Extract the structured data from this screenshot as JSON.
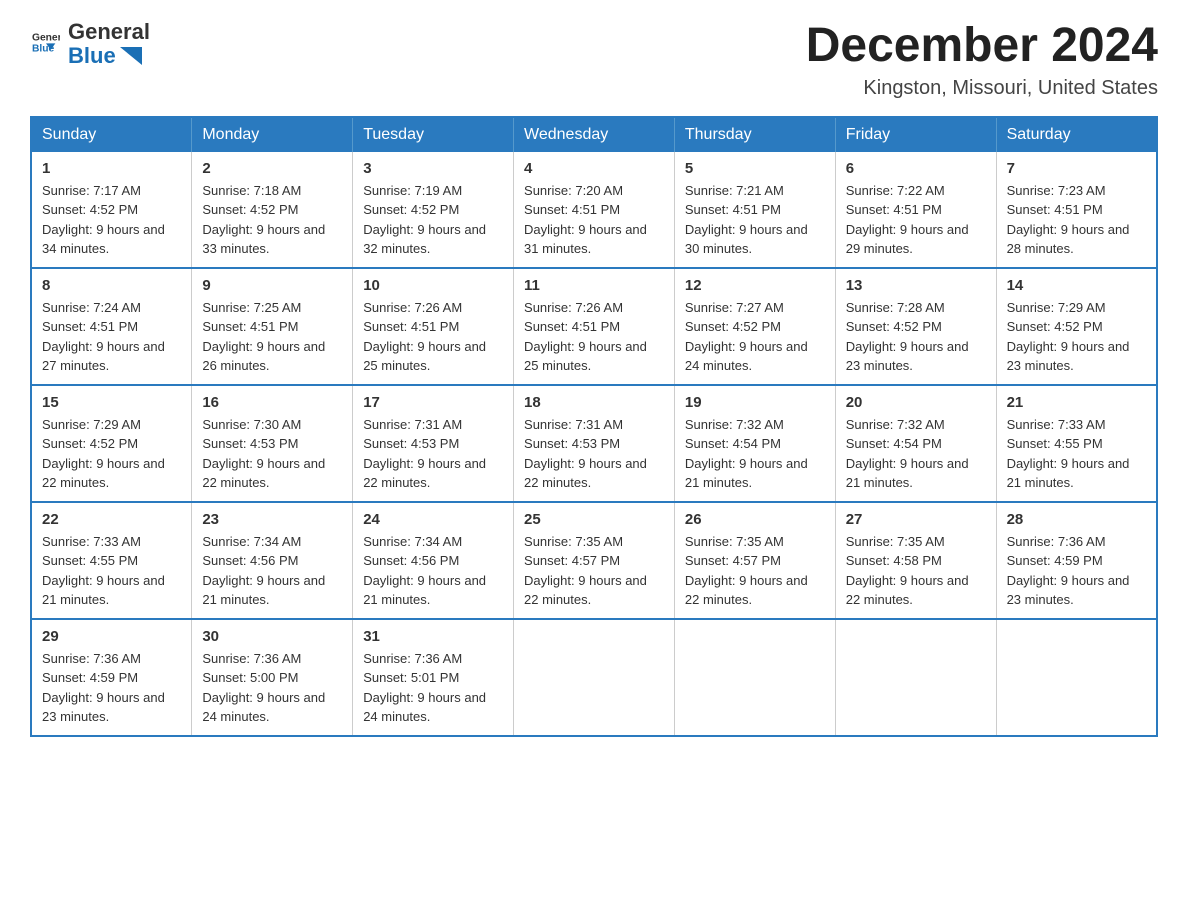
{
  "header": {
    "logo_text_general": "General",
    "logo_text_blue": "Blue",
    "month_title": "December 2024",
    "location": "Kingston, Missouri, United States"
  },
  "weekdays": [
    "Sunday",
    "Monday",
    "Tuesday",
    "Wednesday",
    "Thursday",
    "Friday",
    "Saturday"
  ],
  "weeks": [
    [
      {
        "day": "1",
        "sunrise": "7:17 AM",
        "sunset": "4:52 PM",
        "daylight": "9 hours and 34 minutes."
      },
      {
        "day": "2",
        "sunrise": "7:18 AM",
        "sunset": "4:52 PM",
        "daylight": "9 hours and 33 minutes."
      },
      {
        "day": "3",
        "sunrise": "7:19 AM",
        "sunset": "4:52 PM",
        "daylight": "9 hours and 32 minutes."
      },
      {
        "day": "4",
        "sunrise": "7:20 AM",
        "sunset": "4:51 PM",
        "daylight": "9 hours and 31 minutes."
      },
      {
        "day": "5",
        "sunrise": "7:21 AM",
        "sunset": "4:51 PM",
        "daylight": "9 hours and 30 minutes."
      },
      {
        "day": "6",
        "sunrise": "7:22 AM",
        "sunset": "4:51 PM",
        "daylight": "9 hours and 29 minutes."
      },
      {
        "day": "7",
        "sunrise": "7:23 AM",
        "sunset": "4:51 PM",
        "daylight": "9 hours and 28 minutes."
      }
    ],
    [
      {
        "day": "8",
        "sunrise": "7:24 AM",
        "sunset": "4:51 PM",
        "daylight": "9 hours and 27 minutes."
      },
      {
        "day": "9",
        "sunrise": "7:25 AM",
        "sunset": "4:51 PM",
        "daylight": "9 hours and 26 minutes."
      },
      {
        "day": "10",
        "sunrise": "7:26 AM",
        "sunset": "4:51 PM",
        "daylight": "9 hours and 25 minutes."
      },
      {
        "day": "11",
        "sunrise": "7:26 AM",
        "sunset": "4:51 PM",
        "daylight": "9 hours and 25 minutes."
      },
      {
        "day": "12",
        "sunrise": "7:27 AM",
        "sunset": "4:52 PM",
        "daylight": "9 hours and 24 minutes."
      },
      {
        "day": "13",
        "sunrise": "7:28 AM",
        "sunset": "4:52 PM",
        "daylight": "9 hours and 23 minutes."
      },
      {
        "day": "14",
        "sunrise": "7:29 AM",
        "sunset": "4:52 PM",
        "daylight": "9 hours and 23 minutes."
      }
    ],
    [
      {
        "day": "15",
        "sunrise": "7:29 AM",
        "sunset": "4:52 PM",
        "daylight": "9 hours and 22 minutes."
      },
      {
        "day": "16",
        "sunrise": "7:30 AM",
        "sunset": "4:53 PM",
        "daylight": "9 hours and 22 minutes."
      },
      {
        "day": "17",
        "sunrise": "7:31 AM",
        "sunset": "4:53 PM",
        "daylight": "9 hours and 22 minutes."
      },
      {
        "day": "18",
        "sunrise": "7:31 AM",
        "sunset": "4:53 PM",
        "daylight": "9 hours and 22 minutes."
      },
      {
        "day": "19",
        "sunrise": "7:32 AM",
        "sunset": "4:54 PM",
        "daylight": "9 hours and 21 minutes."
      },
      {
        "day": "20",
        "sunrise": "7:32 AM",
        "sunset": "4:54 PM",
        "daylight": "9 hours and 21 minutes."
      },
      {
        "day": "21",
        "sunrise": "7:33 AM",
        "sunset": "4:55 PM",
        "daylight": "9 hours and 21 minutes."
      }
    ],
    [
      {
        "day": "22",
        "sunrise": "7:33 AM",
        "sunset": "4:55 PM",
        "daylight": "9 hours and 21 minutes."
      },
      {
        "day": "23",
        "sunrise": "7:34 AM",
        "sunset": "4:56 PM",
        "daylight": "9 hours and 21 minutes."
      },
      {
        "day": "24",
        "sunrise": "7:34 AM",
        "sunset": "4:56 PM",
        "daylight": "9 hours and 21 minutes."
      },
      {
        "day": "25",
        "sunrise": "7:35 AM",
        "sunset": "4:57 PM",
        "daylight": "9 hours and 22 minutes."
      },
      {
        "day": "26",
        "sunrise": "7:35 AM",
        "sunset": "4:57 PM",
        "daylight": "9 hours and 22 minutes."
      },
      {
        "day": "27",
        "sunrise": "7:35 AM",
        "sunset": "4:58 PM",
        "daylight": "9 hours and 22 minutes."
      },
      {
        "day": "28",
        "sunrise": "7:36 AM",
        "sunset": "4:59 PM",
        "daylight": "9 hours and 23 minutes."
      }
    ],
    [
      {
        "day": "29",
        "sunrise": "7:36 AM",
        "sunset": "4:59 PM",
        "daylight": "9 hours and 23 minutes."
      },
      {
        "day": "30",
        "sunrise": "7:36 AM",
        "sunset": "5:00 PM",
        "daylight": "9 hours and 24 minutes."
      },
      {
        "day": "31",
        "sunrise": "7:36 AM",
        "sunset": "5:01 PM",
        "daylight": "9 hours and 24 minutes."
      },
      null,
      null,
      null,
      null
    ]
  ]
}
